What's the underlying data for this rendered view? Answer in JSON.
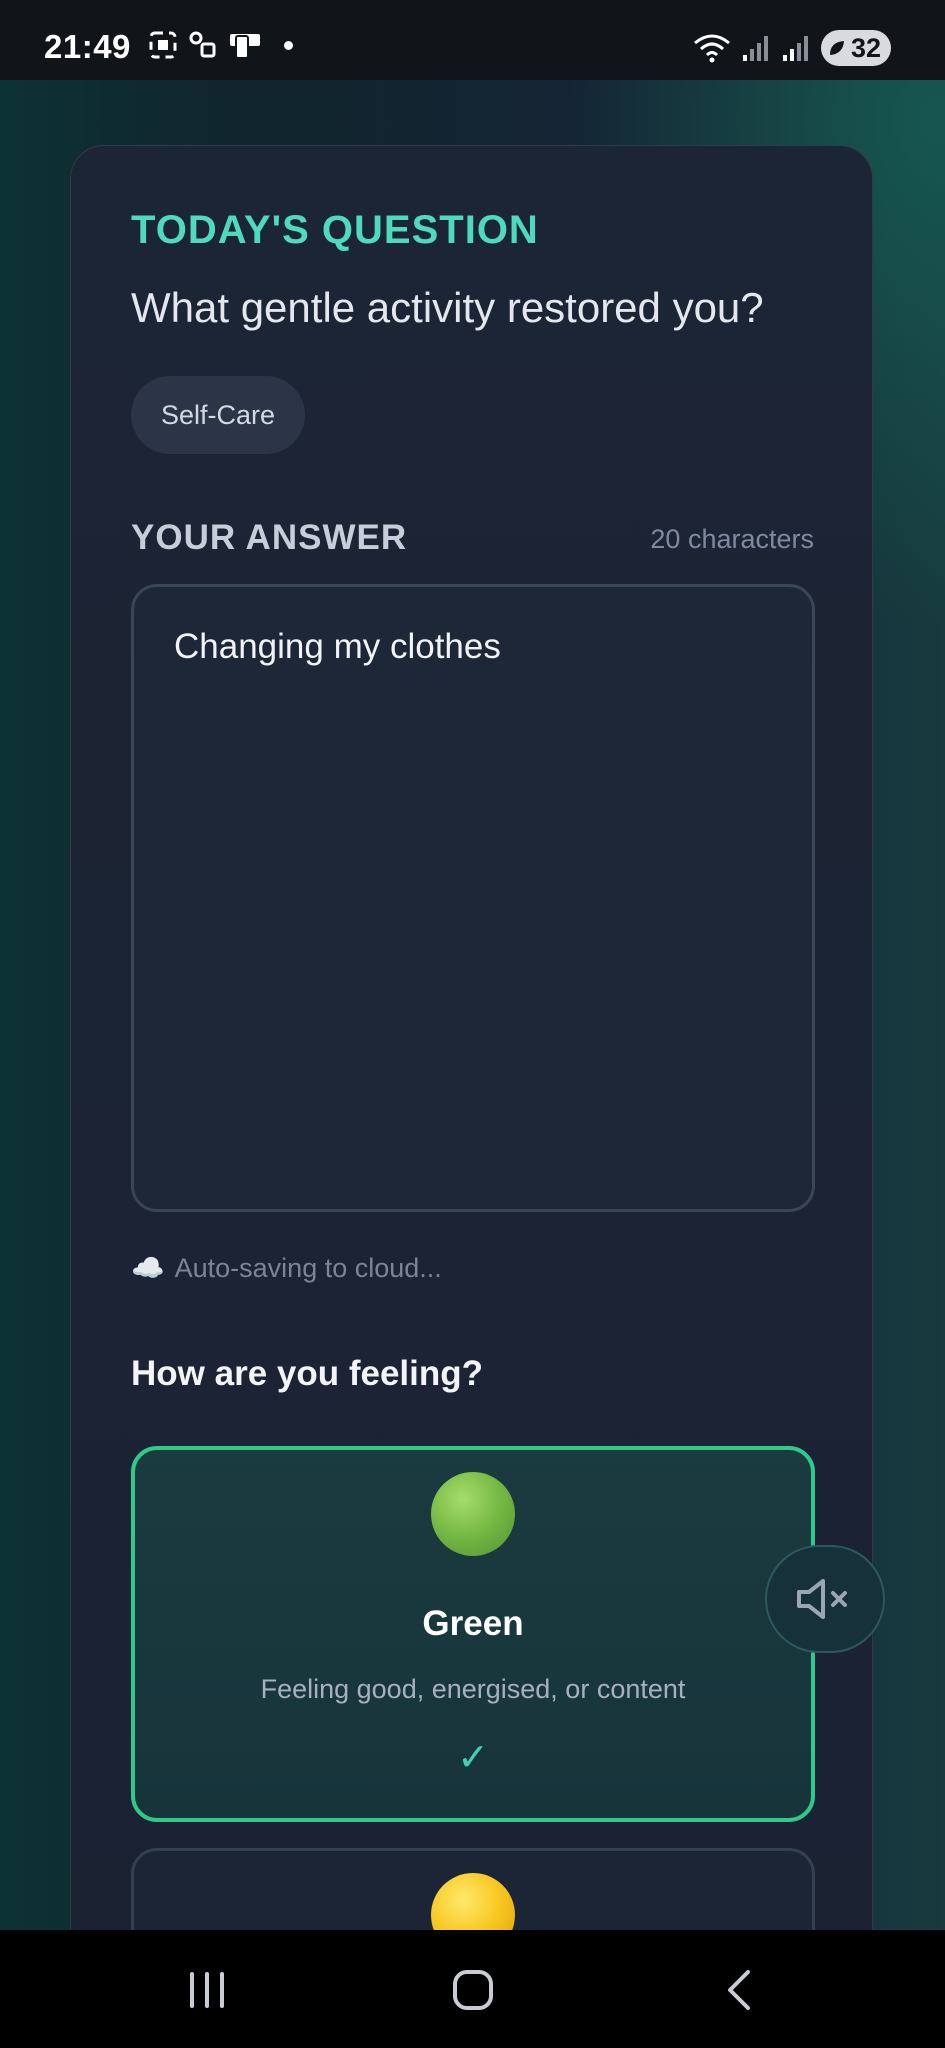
{
  "status_bar": {
    "time": "21:49",
    "battery": "32"
  },
  "question": {
    "heading": "TODAY'S QUESTION",
    "text": "What gentle activity restored you?",
    "tag": "Self-Care"
  },
  "answer": {
    "label": "YOUR ANSWER",
    "char_count": "20 characters",
    "value": "Changing my clothes",
    "autosave_icon": "☁️",
    "autosave_text": "Auto-saving to cloud..."
  },
  "feeling": {
    "heading": "How are you feeling?",
    "options": [
      {
        "title": "Green",
        "description": "Feeling good, energised, or content",
        "check": "✓",
        "selected": true,
        "color": "#2fc98a"
      },
      {
        "selected": false,
        "color": "#f8c51f"
      }
    ]
  },
  "controls": {
    "mute_icon": "volume-muted-icon"
  },
  "nav": {
    "recents_icon": "recents-icon",
    "home_icon": "home-icon",
    "back_icon": "back-icon"
  }
}
